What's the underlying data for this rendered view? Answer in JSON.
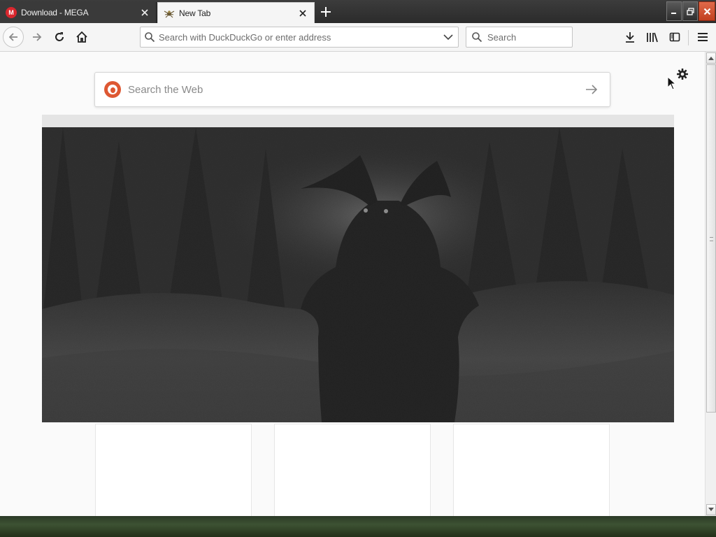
{
  "tabs": [
    {
      "label": "Download - MEGA",
      "favicon_text": "M",
      "active": false
    },
    {
      "label": "New Tab",
      "active": true
    }
  ],
  "toolbar": {
    "urlbar_placeholder": "Search with DuckDuckGo or enter address",
    "searchbar_placeholder": "Search"
  },
  "newtab": {
    "search_placeholder": "Search the Web"
  },
  "colors": {
    "ddg_orange": "#de5833",
    "mega_red": "#d9272e",
    "window_close": "#c2401f"
  }
}
